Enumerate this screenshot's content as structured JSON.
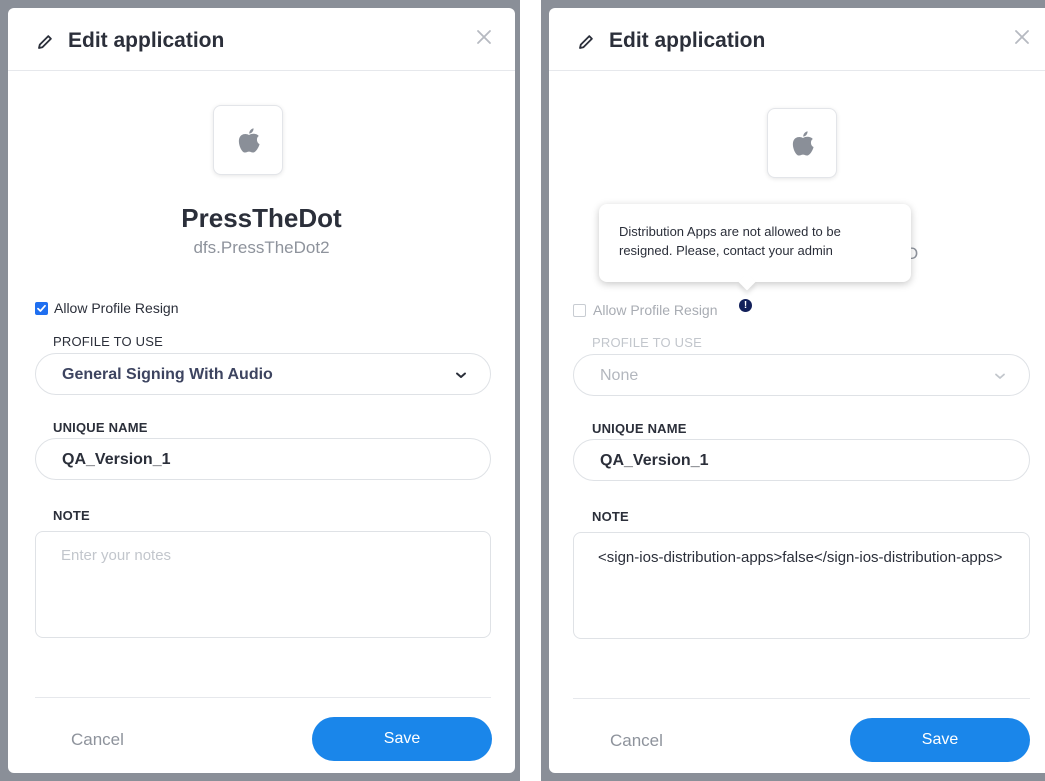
{
  "left_dialog": {
    "title": "Edit application",
    "app_name": "PressTheDot",
    "bundle_id": "dfs.PressTheDot2",
    "allow_profile_resign": {
      "label": "Allow Profile Resign",
      "checked": true
    },
    "profile_label": "PROFILE TO USE",
    "profile_value": "General Signing With Audio",
    "unique_name_label": "UNIQUE NAME",
    "unique_name_value": "QA_Version_1",
    "note_label": "NOTE",
    "note_placeholder": "Enter your notes",
    "cancel_label": "Cancel",
    "save_label": "Save"
  },
  "right_dialog": {
    "title": "Edit application",
    "bundle_id_fragment": "O",
    "tooltip_text": "Distribution Apps are not allowed to be resigned. Please, contact your admin",
    "info_icon_glyph": "!",
    "allow_profile_resign": {
      "label": "Allow Profile Resign",
      "checked": false
    },
    "profile_label": "PROFILE TO USE",
    "profile_value": "None",
    "unique_name_label": "UNIQUE NAME",
    "unique_name_value": "QA_Version_1",
    "note_label": "NOTE",
    "note_value": "<sign-ios-distribution-apps>false</sign-ios-distribution-apps>",
    "cancel_label": "Cancel",
    "save_label": "Save"
  },
  "colors": {
    "accent": "#1a86ea",
    "checkbox": "#1f6ff0",
    "info_dot": "#12205a",
    "backdrop": "#8a8f98"
  },
  "icons": [
    "pencil-icon",
    "close-icon",
    "apple-icon",
    "chevron-down-icon",
    "checkmark-icon",
    "info-icon"
  ]
}
